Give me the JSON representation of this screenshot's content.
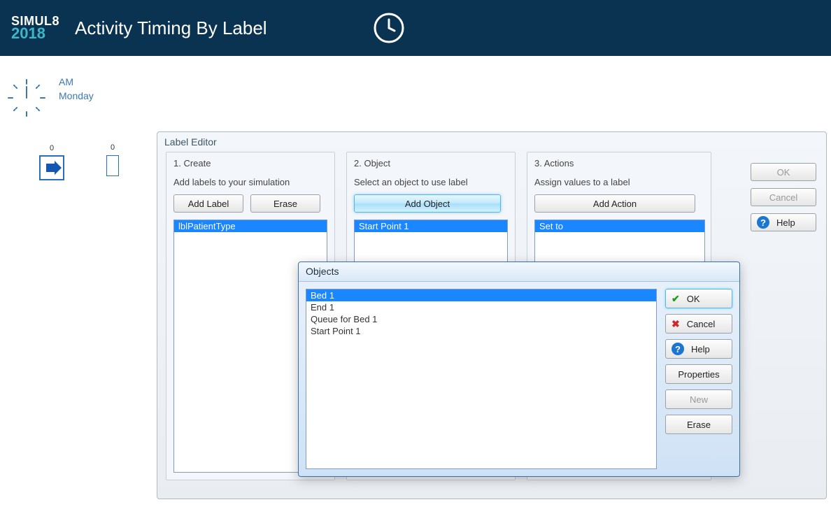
{
  "brand": {
    "name": "SIMUL8",
    "year": "2018"
  },
  "page_title": "Activity Timing By Label",
  "sim_clock": {
    "period": "AM",
    "day": "Monday"
  },
  "canvas": {
    "startpoint_count": "0",
    "queue_count": "0"
  },
  "label_editor": {
    "title": "Label Editor",
    "create": {
      "heading": "1. Create",
      "subtext": "Add labels to your simulation",
      "add_label_btn": "Add Label",
      "erase_btn": "Erase",
      "items": [
        "lblPatientType"
      ]
    },
    "object": {
      "heading": "2. Object",
      "subtext": "Select an object to use label",
      "add_object_btn": "Add Object",
      "items": [
        "Start Point 1"
      ]
    },
    "actions": {
      "heading": "3. Actions",
      "subtext": "Assign values to a label",
      "add_action_btn": "Add Action",
      "items": [
        "Set to"
      ]
    },
    "side": {
      "ok": "OK",
      "cancel": "Cancel",
      "help": "Help"
    }
  },
  "objects_dialog": {
    "title": "Objects",
    "items": [
      "Bed 1",
      "End 1",
      "Queue for Bed 1",
      "Start Point 1"
    ],
    "selected_index": 0,
    "buttons": {
      "ok": "OK",
      "cancel": "Cancel",
      "help": "Help",
      "properties": "Properties",
      "new": "New",
      "erase": "Erase"
    }
  }
}
